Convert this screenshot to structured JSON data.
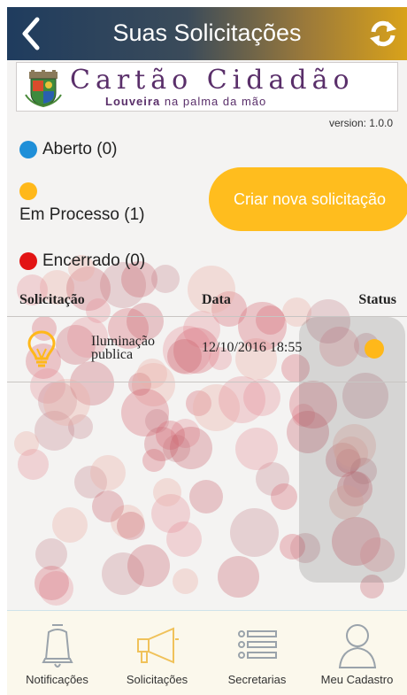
{
  "header": {
    "title": "Suas Solicitações",
    "back_icon": "chevron-left-icon",
    "refresh_icon": "refresh-icon"
  },
  "banner": {
    "title": "Cartão Cidadão",
    "subtitle_bold": "Louveira",
    "subtitle_rest": "na palma da mão",
    "emblem": "city-coat-of-arms"
  },
  "version": "version: 1.0.0",
  "legend": {
    "aberto": "Aberto (0)",
    "em_processo": "Em Processo (1)",
    "encerrado": "Encerrado (0)"
  },
  "new_request_button": "Criar nova solicitação",
  "table": {
    "columns": [
      "Solicitação",
      "Data",
      "Status"
    ],
    "rows": [
      {
        "icon": "lightbulb-icon",
        "name": "Iluminação publica",
        "date": "12/10/2016 18:55",
        "status_color": "#ffb81a"
      }
    ]
  },
  "colors": {
    "aberto": "#1f8fd8",
    "em_processo": "#ffb81a",
    "encerrado": "#e21414",
    "accent": "#ffbd1e",
    "banner_text": "#5a2f6a"
  },
  "tabs": [
    {
      "label": "Notificações",
      "icon": "bell-icon"
    },
    {
      "label": "Solicitações",
      "icon": "megaphone-icon"
    },
    {
      "label": "Secretarias",
      "icon": "list-icon"
    },
    {
      "label": "Meu Cadastro",
      "icon": "user-icon"
    }
  ]
}
